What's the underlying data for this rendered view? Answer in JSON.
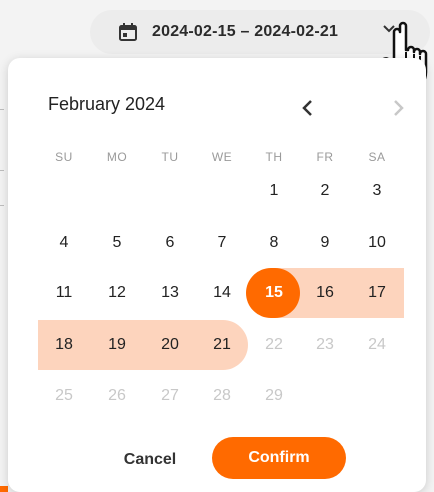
{
  "trigger": {
    "range_text": "2024-02-15 – 2024-02-21",
    "icon": "calendar-icon",
    "chevron_icon": "chevron-down-icon"
  },
  "calendar": {
    "month_label": "February 2024",
    "weekdays": [
      "SU",
      "MO",
      "TU",
      "WE",
      "TH",
      "FR",
      "SA"
    ],
    "weeks": [
      [
        "",
        "",
        "",
        "",
        "1",
        "2",
        "3"
      ],
      [
        "4",
        "5",
        "6",
        "7",
        "8",
        "9",
        "10"
      ],
      [
        "11",
        "12",
        "13",
        "14",
        "15",
        "16",
        "17"
      ],
      [
        "18",
        "19",
        "20",
        "21",
        "22",
        "23",
        "24"
      ],
      [
        "25",
        "26",
        "27",
        "28",
        "29",
        "",
        ""
      ]
    ],
    "selected_start": "15",
    "selected_end": "21",
    "disabled_after": "21"
  },
  "actions": {
    "cancel_label": "Cancel",
    "confirm_label": "Confirm"
  },
  "colors": {
    "accent": "#ff6a00",
    "range_fill": "#fdd4bd"
  }
}
